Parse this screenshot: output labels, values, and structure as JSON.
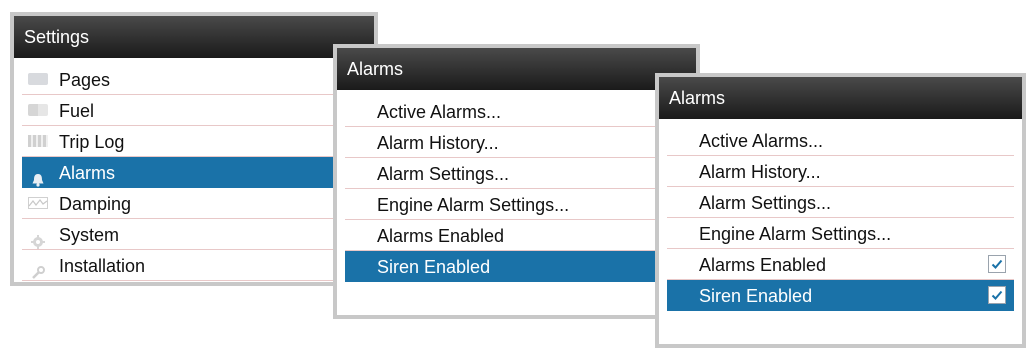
{
  "settings_panel": {
    "title": "Settings",
    "items": [
      {
        "label": "Pages",
        "icon": "pages-icon"
      },
      {
        "label": "Fuel",
        "icon": "fuel-icon"
      },
      {
        "label": "Trip Log",
        "icon": "trip-log-icon"
      },
      {
        "label": "Alarms",
        "icon": "bell-icon",
        "selected": true
      },
      {
        "label": "Damping",
        "icon": "damping-icon"
      },
      {
        "label": "System",
        "icon": "gear-icon"
      },
      {
        "label": "Installation",
        "icon": "wrench-icon"
      }
    ]
  },
  "alarms_panel_1": {
    "title": "Alarms",
    "items": [
      {
        "label": "Active Alarms..."
      },
      {
        "label": "Alarm History..."
      },
      {
        "label": "Alarm Settings..."
      },
      {
        "label": "Engine Alarm Settings..."
      },
      {
        "label": "Alarms Enabled",
        "checked": true
      },
      {
        "label": "Siren Enabled",
        "checked": false,
        "selected": true
      }
    ]
  },
  "alarms_panel_2": {
    "title": "Alarms",
    "items": [
      {
        "label": "Active Alarms..."
      },
      {
        "label": "Alarm History..."
      },
      {
        "label": "Alarm Settings..."
      },
      {
        "label": "Engine Alarm Settings..."
      },
      {
        "label": "Alarms Enabled",
        "checked": true
      },
      {
        "label": "Siren Enabled",
        "checked": true,
        "selected": true
      }
    ]
  },
  "colors": {
    "selection": "#1a72a8",
    "titlebar": "#2a2a2a",
    "panel_border": "#c8c8c8",
    "check": "#1a72a8"
  }
}
